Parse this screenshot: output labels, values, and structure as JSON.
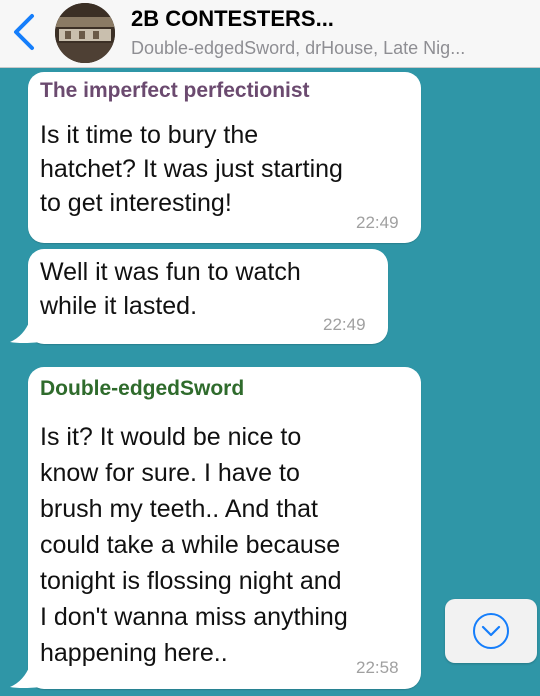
{
  "header": {
    "back_icon": "chevron-left-icon",
    "title": "2B CONTESTERS...",
    "subtitle": "Double-edgedSword, drHouse, Late Nig...",
    "accent_color": "#157efb"
  },
  "messages": [
    {
      "sender": "The imperfect perfectionist",
      "sender_color": "#6b4a6f",
      "lines": [
        "Is it time to bury the",
        "hatchet? It was just starting",
        "to get interesting!"
      ],
      "time": "22:49"
    },
    {
      "sender": "",
      "lines": [
        "Well it was fun to watch",
        "while it lasted."
      ],
      "time": "22:49"
    },
    {
      "sender": "Double-edgedSword",
      "sender_color": "#2f6b2c",
      "lines": [
        "Is it? It would be nice to",
        "know for sure. I have to",
        "brush my teeth.. And that",
        "could take a while because",
        "tonight is flossing night and",
        "I don't wanna miss anything",
        "happening here.."
      ],
      "time": "22:58"
    }
  ],
  "scroll_down_button": {
    "icon": "chevron-down-circle-icon"
  },
  "colors": {
    "chat_background": "#2f96a7",
    "bubble": "#ffffff",
    "timestamp": "#a0a0a0"
  }
}
